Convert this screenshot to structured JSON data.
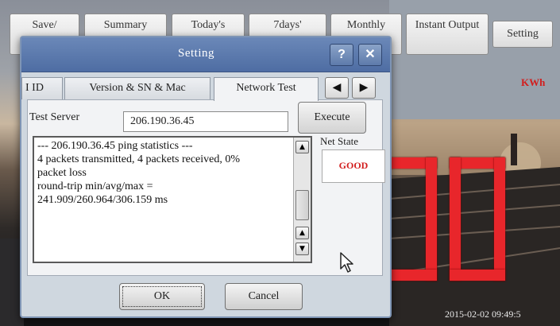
{
  "app": {
    "tabs": [
      {
        "label": "Save/"
      },
      {
        "label": "Summary"
      },
      {
        "label": "Today's"
      },
      {
        "label": "7days'"
      },
      {
        "label": "Monthly"
      },
      {
        "label": "Instant Output"
      }
    ],
    "setting_tab": "Setting",
    "unit_label": "KWh",
    "datetime": "2015-02-02 09:49:5"
  },
  "dialog": {
    "title": "Setting",
    "help_glyph": "?",
    "close_glyph": "✕",
    "tabs": [
      {
        "label": "I ID"
      },
      {
        "label": "Version & SN & Mac"
      },
      {
        "label": "Network Test"
      }
    ],
    "tab_prev_glyph": "◀",
    "tab_next_glyph": "▶",
    "test_server_label": "Test Server",
    "test_server_value": "206.190.36.45",
    "execute_label": "Execute",
    "output_lines": [
      "--- 206.190.36.45 ping statistics ---",
      "4 packets transmitted, 4 packets received, 0%",
      "packet loss",
      "round-trip min/avg/max =",
      "241.909/260.964/306.159 ms"
    ],
    "scroll_up_glyph": "▲",
    "scroll_down_glyph": "▼",
    "net_state_label": "Net State",
    "net_state_value": "GOOD",
    "ok_label": "OK",
    "cancel_label": "Cancel"
  },
  "colors": {
    "accent_red": "#d21d1d",
    "title_bar": "#5a78ad",
    "dialog_bg": "#cfd7df"
  }
}
